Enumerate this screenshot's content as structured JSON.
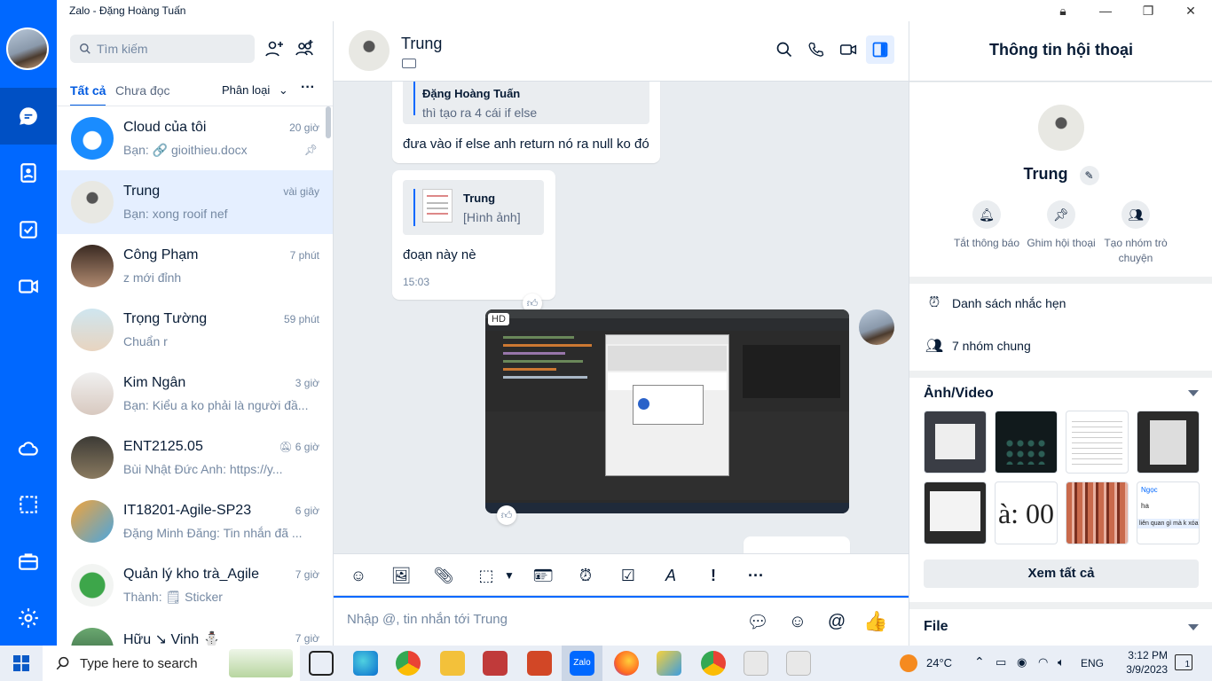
{
  "window": {
    "title": "Zalo - Đặng Hoàng Tuấn",
    "buttons": [
      "lock",
      "minimize",
      "maximize",
      "close"
    ]
  },
  "nav": {
    "items": [
      "chat",
      "contacts",
      "todo",
      "video",
      "cloud",
      "screenshot",
      "toolbox",
      "settings"
    ],
    "active": "chat"
  },
  "sidebar": {
    "search_placeholder": "Tìm kiếm",
    "tabs": {
      "all": "Tất cả",
      "unread": "Chưa đọc",
      "classify": "Phân loại"
    },
    "conversations": [
      {
        "name": "Cloud của tôi",
        "time": "20 giờ",
        "preview": "Bạn: 🔗 gioithieu.docx",
        "pinned": true
      },
      {
        "name": "Trung",
        "time": "vài giây",
        "preview": "Bạn: xong rooif nef",
        "selected": true
      },
      {
        "name": "Công Phạm",
        "time": "7 phút",
        "preview": "z mới đỉnh"
      },
      {
        "name": "Trọng Tường",
        "time": "59 phút",
        "preview": "Chuẩn r"
      },
      {
        "name": "Kim Ngân",
        "time": "3 giờ",
        "preview": "Bạn: Kiểu a ko phải là người đầ..."
      },
      {
        "name": "ENT2125.05",
        "time": "6 giờ",
        "preview": "Bùi Nhật Đức Anh: https://y...",
        "muted": true
      },
      {
        "name": "IT18201-Agile-SP23",
        "time": "6 giờ",
        "preview": "Đặng Minh Đăng: Tin nhắn đã ..."
      },
      {
        "name": "Quản lý kho trà_Agile",
        "time": "7 giờ",
        "preview": "Thành: 🗒 Sticker"
      },
      {
        "name": "Hữu ↘ Vinh ⛄",
        "time": "7 giờ",
        "preview": ""
      }
    ]
  },
  "chat": {
    "name": "Trung",
    "messages": {
      "m1_quote_name": "Đặng Hoàng Tuấn",
      "m1_quote_text": "thì tạo ra 4 cái if else",
      "m1_text": "đưa vào if else anh return nó ra null ko đó",
      "m2_quote_name": "Trung",
      "m2_quote_text": "[Hình ảnh]",
      "m2_text": "đoạn này nè",
      "m2_time": "15:03",
      "image_badge": "HD"
    },
    "composer_placeholder": "Nhập @, tin nhắn tới Trung"
  },
  "info": {
    "title": "Thông tin hội thoại",
    "name": "Trung",
    "actions": [
      {
        "label": "Tắt thông báo",
        "icon": "bell-icon"
      },
      {
        "label": "Ghim hội thoại",
        "icon": "pin-icon"
      },
      {
        "label": "Tạo nhóm trò chuyện",
        "icon": "add-group-icon"
      }
    ],
    "reminders": "Danh sách nhắc hẹn",
    "common_groups": "7 nhóm chung",
    "media_title": "Ảnh/Video",
    "see_all": "Xem tất cả",
    "file_title": "File",
    "thumb_text_5": "à: 00",
    "thumb_text_7a": "Ngọc",
    "thumb_text_7b": "ha",
    "thumb_text_7c": "liên quan gì mà k xóa"
  },
  "taskbar": {
    "search_placeholder": "Type here to search",
    "weather": "24°C",
    "lang": "ENG",
    "time": "3:12 PM",
    "date": "3/9/2023",
    "notifications": "1"
  },
  "colors": {
    "accent": "#0068ff",
    "nav_bg": "#0068ff",
    "selected_bg": "#e5efff"
  }
}
